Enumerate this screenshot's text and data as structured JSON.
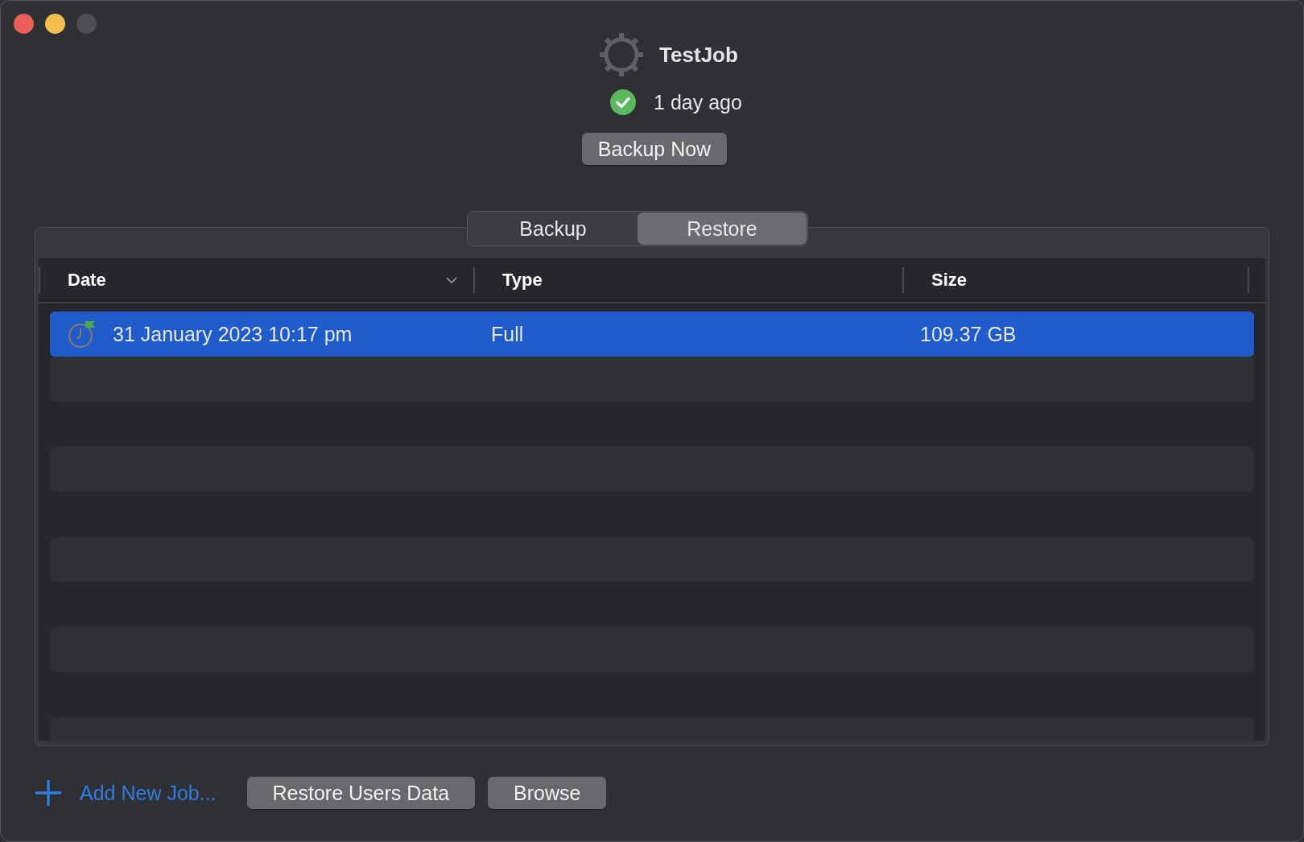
{
  "job": {
    "title": "TestJob",
    "succeeded": true,
    "last_run": "1 day ago",
    "action": "Backup Now"
  },
  "tabs": [
    {
      "label": "Backup",
      "selected": false
    },
    {
      "label": "Restore",
      "selected": true
    }
  ],
  "table": {
    "columns": [
      {
        "label": "Date",
        "sorted": true
      },
      {
        "label": "Type",
        "sorted": false
      },
      {
        "label": "Size",
        "sorted": false
      }
    ],
    "rows": [
      {
        "date": "31 January 2023 10:17 pm",
        "type": "Full",
        "size": "109.37 GB",
        "selected": true
      }
    ]
  },
  "footer": {
    "add_job": "Add New Job...",
    "buttons": [
      "Restore Users Data",
      "Browse"
    ]
  }
}
